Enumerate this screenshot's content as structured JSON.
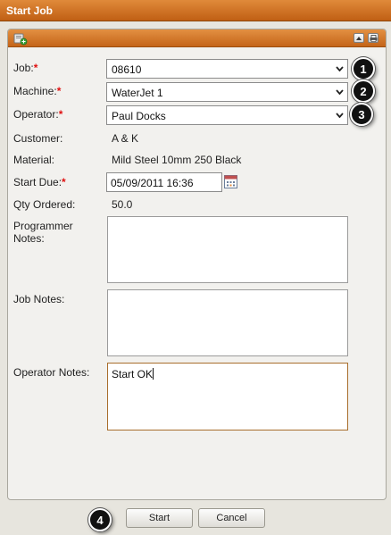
{
  "window": {
    "title": "Start Job"
  },
  "form": {
    "job": {
      "label": "Job:",
      "required_mark": "*",
      "value": "08610"
    },
    "machine": {
      "label": "Machine:",
      "required_mark": "*",
      "value": "WaterJet 1"
    },
    "operator": {
      "label": "Operator:",
      "required_mark": "*",
      "value": "Paul Docks"
    },
    "customer": {
      "label": "Customer:",
      "value": "A & K"
    },
    "material": {
      "label": "Material:",
      "value": "Mild Steel 10mm 250 Black"
    },
    "start_due": {
      "label": "Start Due:",
      "required_mark": "*",
      "value": "05/09/2011 16:36"
    },
    "qty_ordered": {
      "label": "Qty Ordered:",
      "value": "50.0"
    },
    "programmer_notes": {
      "label_line1": "Programmer",
      "label_line2": "Notes:",
      "value": ""
    },
    "job_notes": {
      "label": "Job Notes:",
      "value": ""
    },
    "operator_notes": {
      "label": "Operator Notes:",
      "value": "Start OK"
    }
  },
  "buttons": {
    "start": "Start",
    "cancel": "Cancel"
  },
  "callouts": [
    "1",
    "2",
    "3",
    "4"
  ],
  "icons": {
    "header": "add-job-icon",
    "collapse": "collapse-icon",
    "print": "print-icon",
    "dropdown": "chevron-down-icon",
    "calendar": "calendar-icon"
  },
  "colors": {
    "title_bar": "#c96a1e",
    "required": "#e01010",
    "active_border": "#a86e2c"
  }
}
